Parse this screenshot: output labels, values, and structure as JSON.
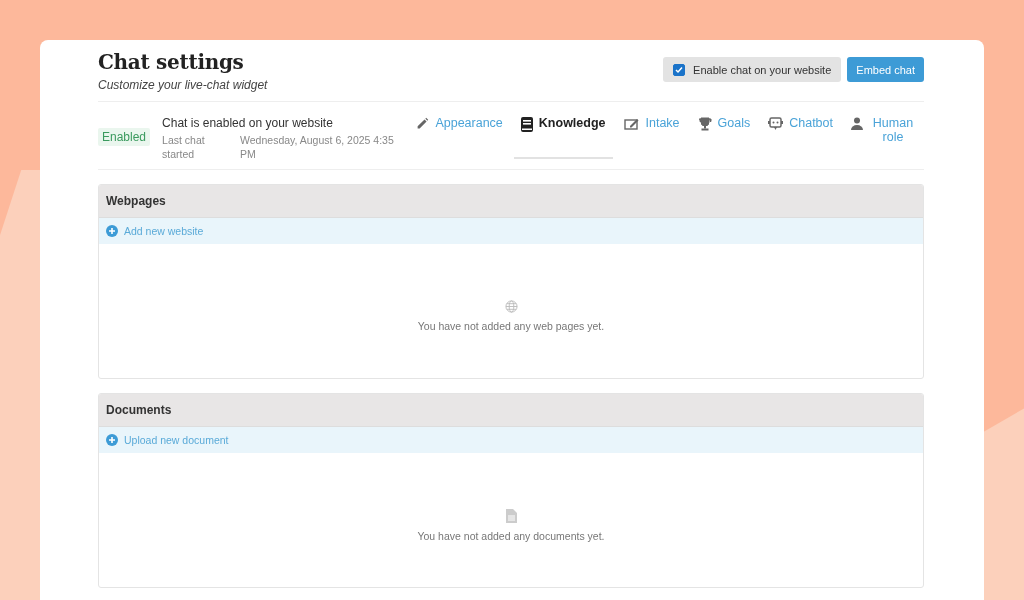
{
  "header": {
    "title": "Chat settings",
    "subtitle": "Customize your live-chat widget",
    "enable_toggle": {
      "label": "Enable chat on your website",
      "checked": true
    },
    "embed_button": "Embed chat"
  },
  "status": {
    "badge": "Enabled",
    "headline": "Chat is enabled on your website",
    "last_label": "Last chat started",
    "last_value": "Wednesday, August 6, 2025 4:35 PM"
  },
  "tabs": [
    {
      "kind": "pencil",
      "label": "Appearance",
      "selected": false
    },
    {
      "kind": "book",
      "label": "Knowledge",
      "selected": true
    },
    {
      "kind": "edit",
      "label": "Intake",
      "selected": false
    },
    {
      "kind": "trophy",
      "label": "Goals",
      "selected": false
    },
    {
      "kind": "bot",
      "label": "Chatbot",
      "selected": false
    },
    {
      "kind": "person",
      "label": "Human role",
      "selected": false
    }
  ],
  "sections": [
    {
      "kind": "globe",
      "title": "Webpages",
      "action": "Add new website",
      "empty": "You have not added any web pages yet."
    },
    {
      "kind": "document",
      "title": "Documents",
      "action": "Upload new document",
      "empty": "You have not added any documents yet."
    }
  ]
}
